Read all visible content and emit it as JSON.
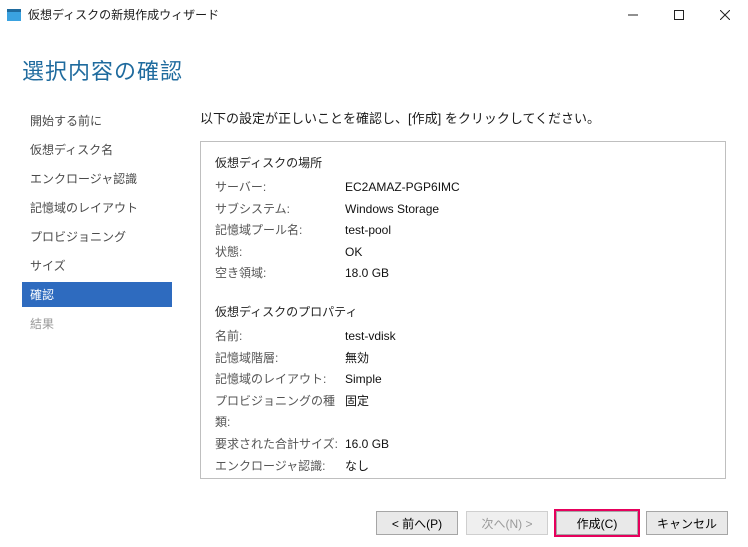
{
  "window": {
    "title": "仮想ディスクの新規作成ウィザード"
  },
  "page": {
    "heading": "選択内容の確認",
    "instruction": "以下の設定が正しいことを確認し、[作成] をクリックしてください。"
  },
  "sidebar": {
    "items": [
      {
        "label": "開始する前に",
        "state": "normal"
      },
      {
        "label": "仮想ディスク名",
        "state": "normal"
      },
      {
        "label": "エンクロージャ認識",
        "state": "normal"
      },
      {
        "label": "記憶域のレイアウト",
        "state": "normal"
      },
      {
        "label": "プロビジョニング",
        "state": "normal"
      },
      {
        "label": "サイズ",
        "state": "normal"
      },
      {
        "label": "確認",
        "state": "active"
      },
      {
        "label": "結果",
        "state": "disabled"
      }
    ]
  },
  "details": {
    "location": {
      "title": "仮想ディスクの場所",
      "rows": [
        {
          "label": "サーバー:",
          "value": "EC2AMAZ-PGP6IMC"
        },
        {
          "label": "サブシステム:",
          "value": "Windows Storage"
        },
        {
          "label": "記憶域プール名:",
          "value": "test-pool"
        },
        {
          "label": "状態:",
          "value": "OK"
        },
        {
          "label": "空き領域:",
          "value": "18.0 GB"
        }
      ]
    },
    "properties": {
      "title": "仮想ディスクのプロパティ",
      "rows": [
        {
          "label": "名前:",
          "value": "test-vdisk"
        },
        {
          "label": "記憶域階層:",
          "value": "無効"
        },
        {
          "label": "記憶域のレイアウト:",
          "value": "Simple"
        },
        {
          "label": "プロビジョニングの種類:",
          "value": "固定"
        },
        {
          "label": "要求された合計サイズ:",
          "value": "16.0 GB"
        },
        {
          "label": "エンクロージャ認識:",
          "value": "なし"
        }
      ]
    }
  },
  "footer": {
    "back": "< 前へ(P)",
    "next": "次へ(N) >",
    "create": "作成(C)",
    "cancel": "キャンセル"
  }
}
